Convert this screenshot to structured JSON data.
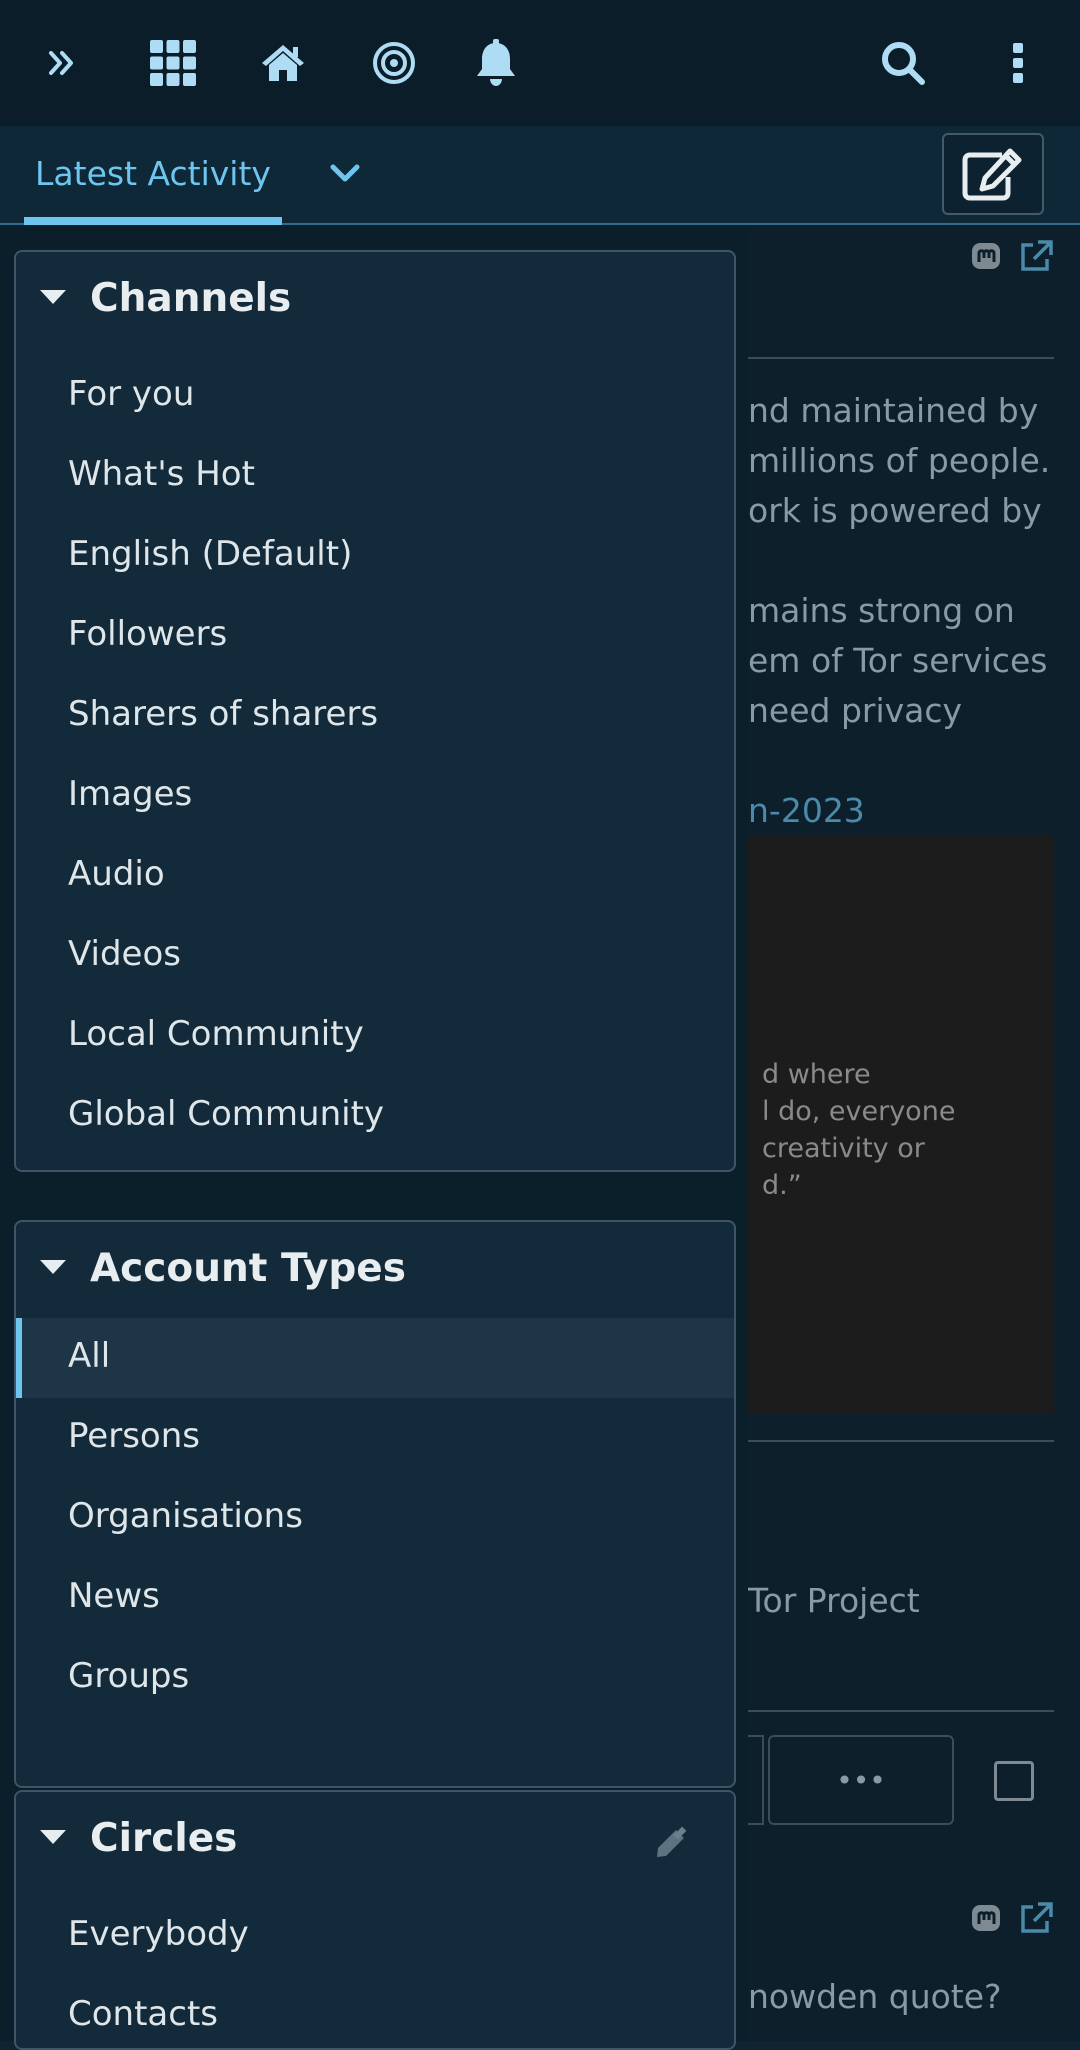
{
  "topbar": {
    "icons": [
      "expand-icon",
      "apps-grid-icon",
      "home-icon",
      "target-icon",
      "bell-icon",
      "search-icon",
      "more-vertical-icon"
    ]
  },
  "tabs": {
    "active_label": "Latest Activity"
  },
  "background_post": {
    "lines": [
      "nd maintained by",
      "millions of people.",
      "ork is powered by",
      "mains strong on",
      "em of Tor services",
      "need privacy"
    ],
    "link_fragment": "n-2023",
    "image_quote_lines": [
      "d where",
      "l do, everyone",
      "creativity or",
      "d.”"
    ],
    "author_fragment": "Tor Project",
    "more_label": "•••",
    "next_post_fragment": "nowden quote?"
  },
  "channels": {
    "title": "Channels",
    "items": [
      "For you",
      "What's Hot",
      "English (Default)",
      "Followers",
      "Sharers of sharers",
      "Images",
      "Audio",
      "Videos",
      "Local Community",
      "Global Community"
    ]
  },
  "account_types": {
    "title": "Account Types",
    "items": [
      "All",
      "Persons",
      "Organisations",
      "News",
      "Groups"
    ],
    "selected_index": 0
  },
  "circles": {
    "title": "Circles",
    "items": [
      "Everybody",
      "Contacts"
    ]
  },
  "colors": {
    "accent": "#6ec6f0",
    "panel_bg": "#122a39",
    "topbar_bg": "#0a1d28"
  }
}
